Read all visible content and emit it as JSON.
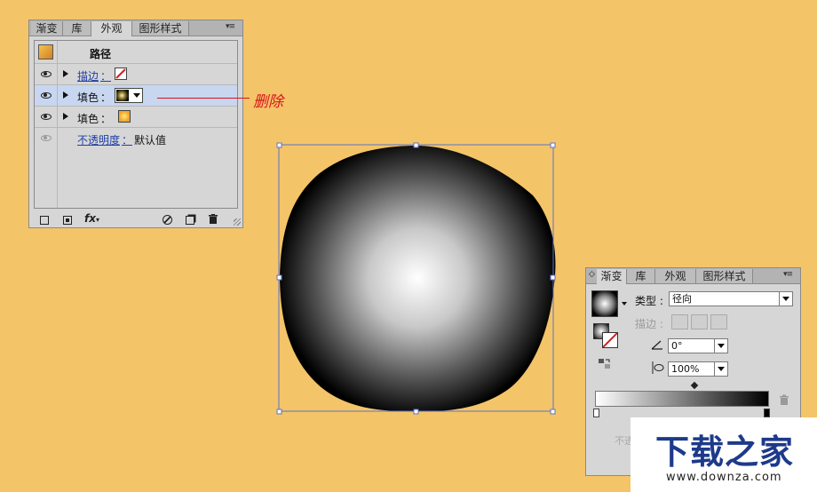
{
  "appearance_panel": {
    "tabs": [
      "渐变",
      "库",
      "外观",
      "图形样式"
    ],
    "menu_glyph": "▾≡",
    "header_label": "路径",
    "rows": [
      {
        "label": "描边",
        "colon": "："
      },
      {
        "label": "填色",
        "colon": "："
      },
      {
        "label": "填色",
        "colon": "："
      },
      {
        "label": "不透明度",
        "colon": "：",
        "value": "默认值"
      }
    ],
    "footer_fx": "fx"
  },
  "annotation": {
    "text": "删除",
    "color": "#d8141e"
  },
  "gradient_panel": {
    "tabs": [
      "渐变",
      "库",
      "外观",
      "图形样式"
    ],
    "menu_glyph": "▾≡",
    "type_label": "类型",
    "type_value": "径向",
    "stroke_label": "描边",
    "angle_value": "0°",
    "aspect_value": "100%",
    "faded_text": "不透"
  },
  "watermark": {
    "title": "下载之家",
    "url": "www.downza.com"
  },
  "colors": {
    "background": "#f4c468",
    "selection": "#c8d6f0",
    "link": "#1f3faa",
    "annotation": "#d8141e"
  }
}
